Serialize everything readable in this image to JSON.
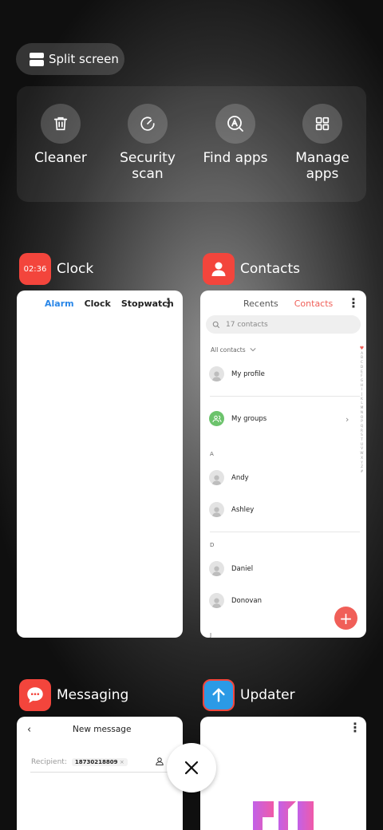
{
  "split_screen": {
    "label": "Split screen"
  },
  "quick_tools": [
    {
      "label": "Cleaner",
      "icon": "trash-icon"
    },
    {
      "label": "Security\nscan",
      "icon": "gauge-icon"
    },
    {
      "label": "Find apps",
      "icon": "search-app-icon"
    },
    {
      "label": "Manage\napps",
      "icon": "grid-icon"
    }
  ],
  "apps": {
    "clock": {
      "name": "Clock",
      "icon_time": "02:36",
      "icon_color": "#f3453c",
      "tabs": [
        "Alarm",
        "Clock",
        "Stopwatch"
      ],
      "active_tab": "Alarm",
      "accent": "#2a87e8"
    },
    "contacts": {
      "name": "Contacts",
      "icon_color": "#f3453c",
      "tabs": [
        "Recents",
        "Contacts"
      ],
      "search_placeholder": "17 contacts",
      "filter": "All contacts",
      "my_profile": "My profile",
      "my_groups": "My groups",
      "section_a": "A",
      "section_d": "D",
      "contacts_a": [
        "Andy",
        "Ashley"
      ],
      "contacts_d": [
        "Daniel",
        "Donovan"
      ],
      "section_next": "J",
      "index_heart": "♥",
      "index_letters": [
        "A",
        "B",
        "C",
        "D",
        "E",
        "F",
        "G",
        "H",
        "I",
        "J",
        "K",
        "L",
        "M",
        "N",
        "O",
        "P",
        "Q",
        "R",
        "S",
        "T",
        "U",
        "V",
        "W",
        "X",
        "Y",
        "Z",
        "#"
      ],
      "accent": "#f05f58"
    },
    "messaging": {
      "name": "Messaging",
      "icon_color": "#f3453c",
      "title": "New message",
      "recipient_label": "Recipient:",
      "recipient_chip": "18730218809",
      "chip_remove": "×"
    },
    "updater": {
      "name": "Updater",
      "icon_color": "#2b9ae6",
      "icon_border": "#f3453c"
    }
  },
  "close_all": {
    "icon": "close-icon"
  }
}
